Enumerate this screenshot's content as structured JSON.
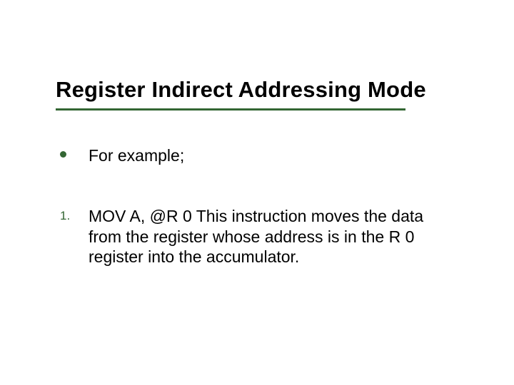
{
  "slide": {
    "title": "Register Indirect Addressing Mode",
    "bullets": [
      {
        "marker": "dot",
        "text": "For example;"
      }
    ],
    "numbered": [
      {
        "num": "1.",
        "text": "MOV A, @R 0 This instruction moves the data from the register whose address is in the R 0 register into the accumulator."
      }
    ]
  }
}
